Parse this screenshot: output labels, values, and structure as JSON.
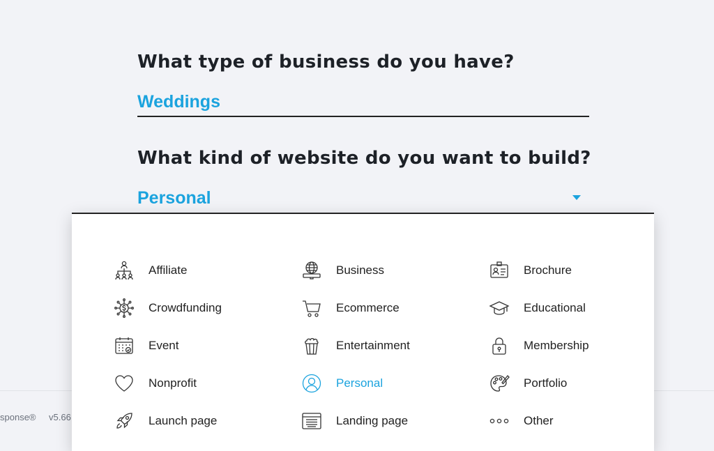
{
  "form": {
    "business_question": "What type of business do you have?",
    "business_value": "Weddings",
    "website_question": "What kind of website do you want to build?",
    "website_value": "Personal"
  },
  "footer": {
    "brand": "sponse®",
    "version": "v5.66"
  },
  "colors": {
    "accent": "#1ba3de",
    "text": "#1d2127",
    "background": "#f2f3f7"
  },
  "dropdown": {
    "items": [
      {
        "label": "Affiliate",
        "icon": "affiliate-network-icon"
      },
      {
        "label": "Business",
        "icon": "globe-monitor-icon"
      },
      {
        "label": "Brochure",
        "icon": "id-card-icon"
      },
      {
        "label": "Crowdfunding",
        "icon": "dollar-network-icon"
      },
      {
        "label": "Ecommerce",
        "icon": "shopping-cart-icon"
      },
      {
        "label": "Educational",
        "icon": "graduation-cap-icon"
      },
      {
        "label": "Event",
        "icon": "calendar-icon"
      },
      {
        "label": "Entertainment",
        "icon": "popcorn-icon"
      },
      {
        "label": "Membership",
        "icon": "padlock-icon"
      },
      {
        "label": "Nonprofit",
        "icon": "heart-icon"
      },
      {
        "label": "Personal",
        "icon": "user-icon",
        "selected": true
      },
      {
        "label": "Portfolio",
        "icon": "palette-icon"
      },
      {
        "label": "Launch page",
        "icon": "rocket-icon"
      },
      {
        "label": "Landing page",
        "icon": "landing-page-icon"
      },
      {
        "label": "Other",
        "icon": "more-dots-icon"
      }
    ]
  }
}
